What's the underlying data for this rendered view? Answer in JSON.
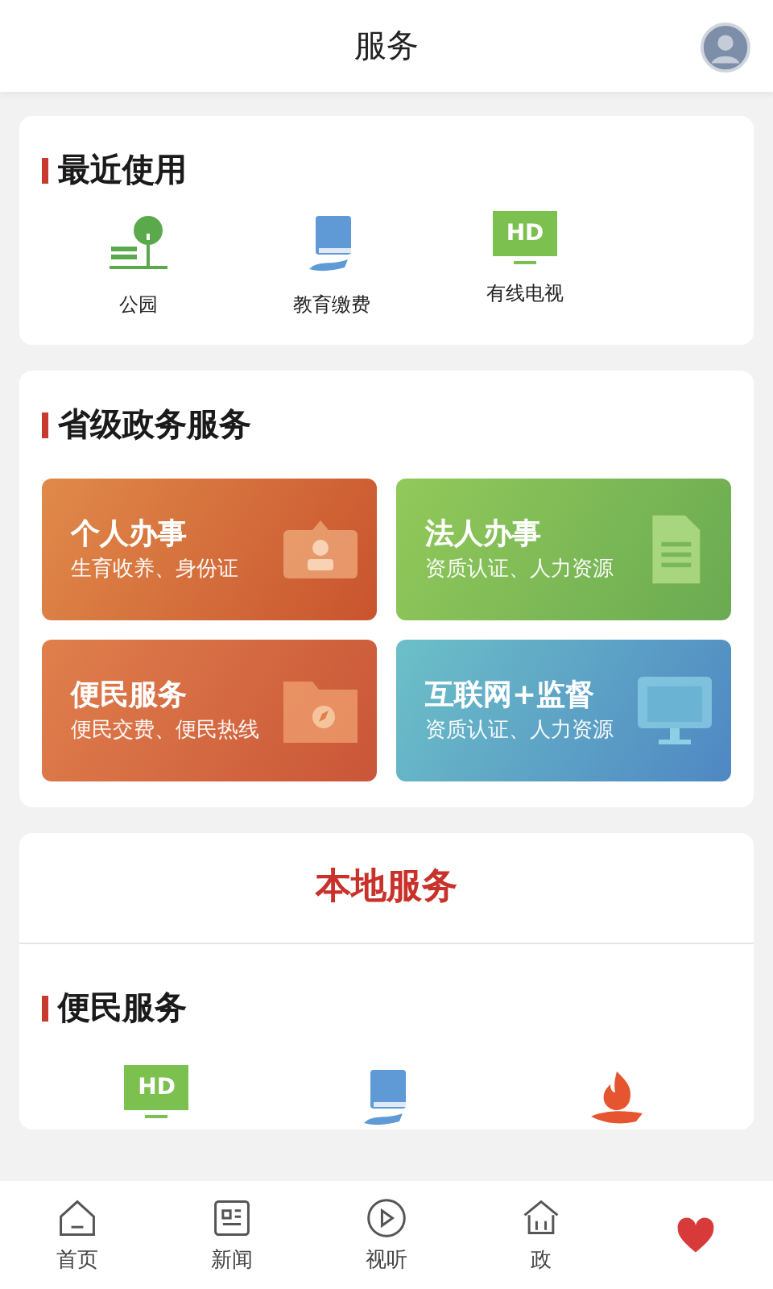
{
  "header": {
    "title": "服务"
  },
  "recent": {
    "title": "最近使用",
    "items": [
      {
        "kind": "park",
        "label": "公园"
      },
      {
        "kind": "book",
        "label": "教育缴费"
      },
      {
        "kind": "tv",
        "icon_text": "HD",
        "label": "有线电视"
      }
    ]
  },
  "provincial": {
    "title": "省级政务服务",
    "tiles": [
      {
        "kind": "person",
        "title": "个人办事",
        "subtitle": "生育收养、身份证"
      },
      {
        "kind": "document",
        "title": "法人办事",
        "subtitle": "资质认证、人力资源"
      },
      {
        "kind": "folder",
        "title": "便民服务",
        "subtitle": "便民交费、便民热线"
      },
      {
        "kind": "monitor",
        "title": "互联网+监督",
        "subtitle": "资质认证、人力资源"
      }
    ]
  },
  "local": {
    "title": "本地服务",
    "section_title": "便民服务",
    "items": [
      {
        "kind": "tv",
        "icon_text": "HD"
      },
      {
        "kind": "book"
      },
      {
        "kind": "fire"
      }
    ]
  },
  "tabbar": [
    {
      "kind": "home",
      "label": "首页"
    },
    {
      "kind": "news",
      "label": "新闻"
    },
    {
      "kind": "play",
      "label": "视听"
    },
    {
      "kind": "gov",
      "label": "政"
    },
    {
      "kind": "heart"
    }
  ]
}
